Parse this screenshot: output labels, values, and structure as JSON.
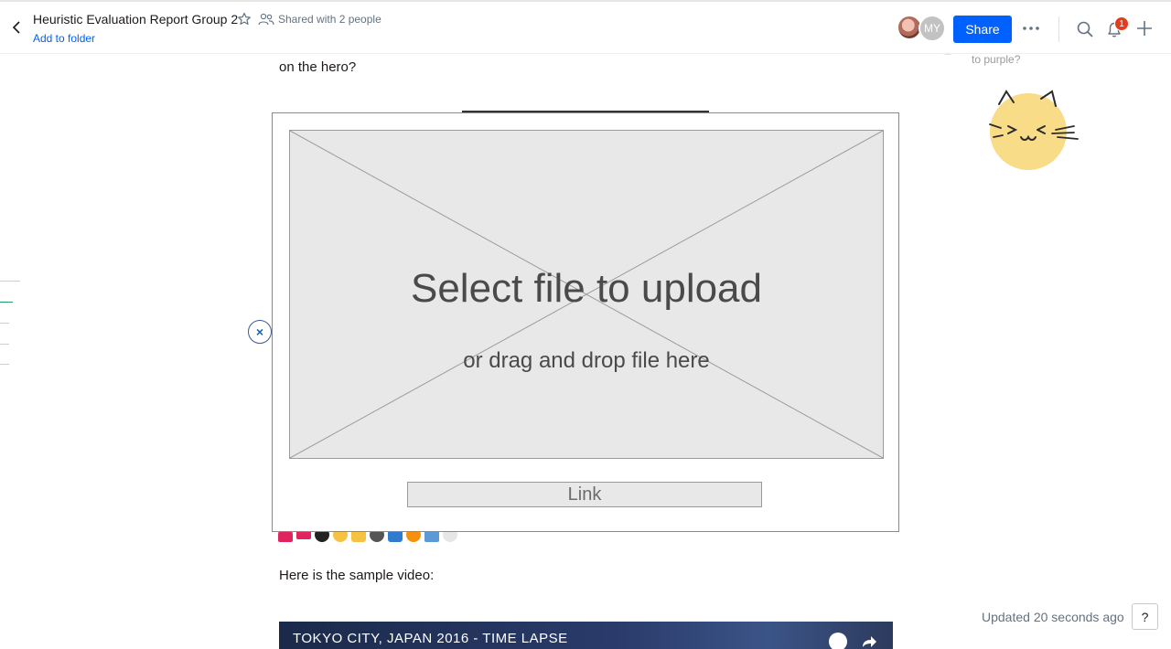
{
  "header": {
    "title": "Heuristic Evaluation Report Group 2",
    "shared": "Shared with 2 people",
    "add_to_folder": "Add to folder",
    "avatar_initials": "MY",
    "share_label": "Share",
    "notification_count": "1",
    "icons": [
      "chevron-left-icon",
      "star-icon",
      "people-icon",
      "more-icon",
      "search-icon",
      "bell-icon",
      "plus-icon"
    ]
  },
  "document": {
    "hero_question": "on the hero?",
    "sample_video_intro": "Here is the sample video:",
    "video_title": "TOKYO CITY, JAPAN 2016 - TIME LAPSE",
    "emoji_reactions": [
      "heart",
      "hundred",
      "8-ball",
      "clap",
      "thumbs-up",
      "raccoon",
      "shirt",
      "orange",
      "picture",
      "speech-bubble"
    ]
  },
  "comment": {
    "fragment": "to purple?"
  },
  "upload": {
    "title": "Select file to upload",
    "subtitle": "or drag and drop file here",
    "link_label": "Link",
    "close_label": "×"
  },
  "footer": {
    "updated": "Updated 20 seconds ago",
    "help_label": "?"
  },
  "colors": {
    "accent": "#0061fe",
    "badge": "#e33b1c",
    "placeholder_gray": "#e8e8e8"
  }
}
